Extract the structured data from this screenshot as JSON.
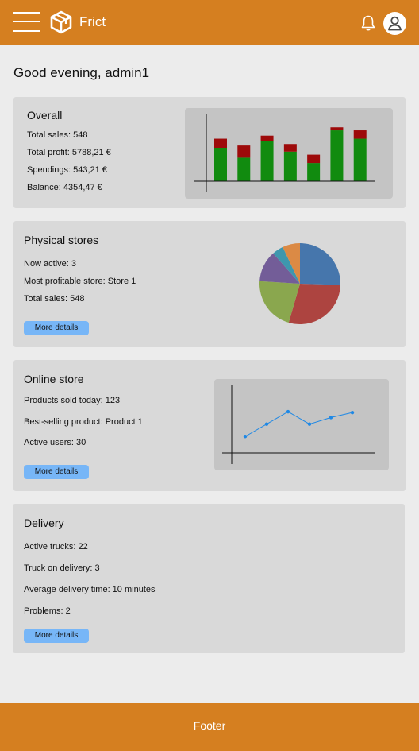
{
  "header": {
    "brand": "Frict",
    "colors": {
      "bar": "#d57f20",
      "icon": "#ffffff"
    },
    "icons": {
      "menu": "hamburger-menu-icon",
      "logo": "box-icon",
      "notifications": "bell-icon",
      "account": "user-icon"
    }
  },
  "greeting": "Good evening, admin1",
  "overall": {
    "title": "Overall",
    "lines": [
      "Total sales: 548",
      "Total profit: 5788,21 €",
      "Spendings: 543,21 €",
      "Balance: 4354,47 €"
    ]
  },
  "physical": {
    "title": "Physical stores",
    "lines": [
      "Now active: 3",
      "Most profitable store: Store 1",
      "Total sales: 548"
    ],
    "button": "More details"
  },
  "online": {
    "title": "Online store",
    "lines": [
      "Products sold today: 123",
      "Best-selling product: Product 1",
      "Active users: 30"
    ],
    "button": "More details"
  },
  "delivery": {
    "title": "Delivery",
    "lines": [
      "Active trucks: 22",
      "Truck on delivery: 3",
      "Average delivery time: 10 minutes",
      "Problems: 2"
    ],
    "button": "More details"
  },
  "footer": {
    "text": "Footer"
  },
  "chart_data": [
    {
      "type": "bar",
      "stacked": true,
      "categories": [
        "1",
        "2",
        "3",
        "4",
        "5",
        "6",
        "7"
      ],
      "series": [
        {
          "values": [
            44,
            31,
            53,
            39,
            24,
            67,
            56
          ],
          "color": "#118b0f"
        },
        {
          "values": [
            12,
            16,
            7,
            10,
            11,
            4,
            11
          ],
          "color": "#9d0a0a"
        }
      ],
      "ylim": [
        0,
        88
      ],
      "grid": false,
      "axis_labels": false
    },
    {
      "type": "pie",
      "slices": [
        {
          "value": 25.5,
          "color": "#4676ac"
        },
        {
          "value": 29.0,
          "color": "#ad4440"
        },
        {
          "value": 21.5,
          "color": "#8aa74e"
        },
        {
          "value": 12.5,
          "color": "#735d98"
        },
        {
          "value": 4.5,
          "color": "#3e97ae"
        },
        {
          "value": 7.0,
          "color": "#db8a45"
        }
      ]
    },
    {
      "type": "line",
      "x": [
        1,
        2,
        3,
        4,
        5,
        6
      ],
      "series": [
        {
          "values": [
            20,
            35,
            50,
            35,
            43,
            49
          ],
          "color": "#1e88e5"
        }
      ],
      "ylim": [
        0,
        80
      ],
      "grid": false,
      "axis_labels": false
    }
  ]
}
